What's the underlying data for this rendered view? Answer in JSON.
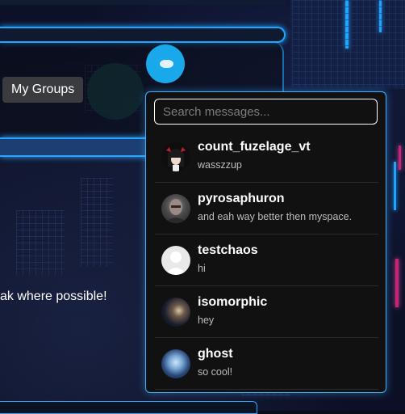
{
  "page": {
    "my_groups_label": "My Groups",
    "story_text": "ak where possible!"
  },
  "messages": {
    "search_placeholder": "Search messages...",
    "search_value": "",
    "items": [
      {
        "name": "count_fuzelage_vt",
        "preview": "wasszzup",
        "avatar": "anime-avatar"
      },
      {
        "name": "pyrosaphuron",
        "preview": "and eah way better then myspace.",
        "avatar": "portrait-avatar"
      },
      {
        "name": "testchaos",
        "preview": "hi",
        "avatar": "default-user-avatar"
      },
      {
        "name": "isomorphic",
        "preview": "hey",
        "avatar": "galaxy-avatar"
      },
      {
        "name": "ghost",
        "preview": "so cool!",
        "avatar": "ghost-avatar"
      }
    ]
  },
  "colors": {
    "accent": "#1ea5ff",
    "chat_button": "#19a9ea",
    "dropdown_bg": "#111111"
  }
}
